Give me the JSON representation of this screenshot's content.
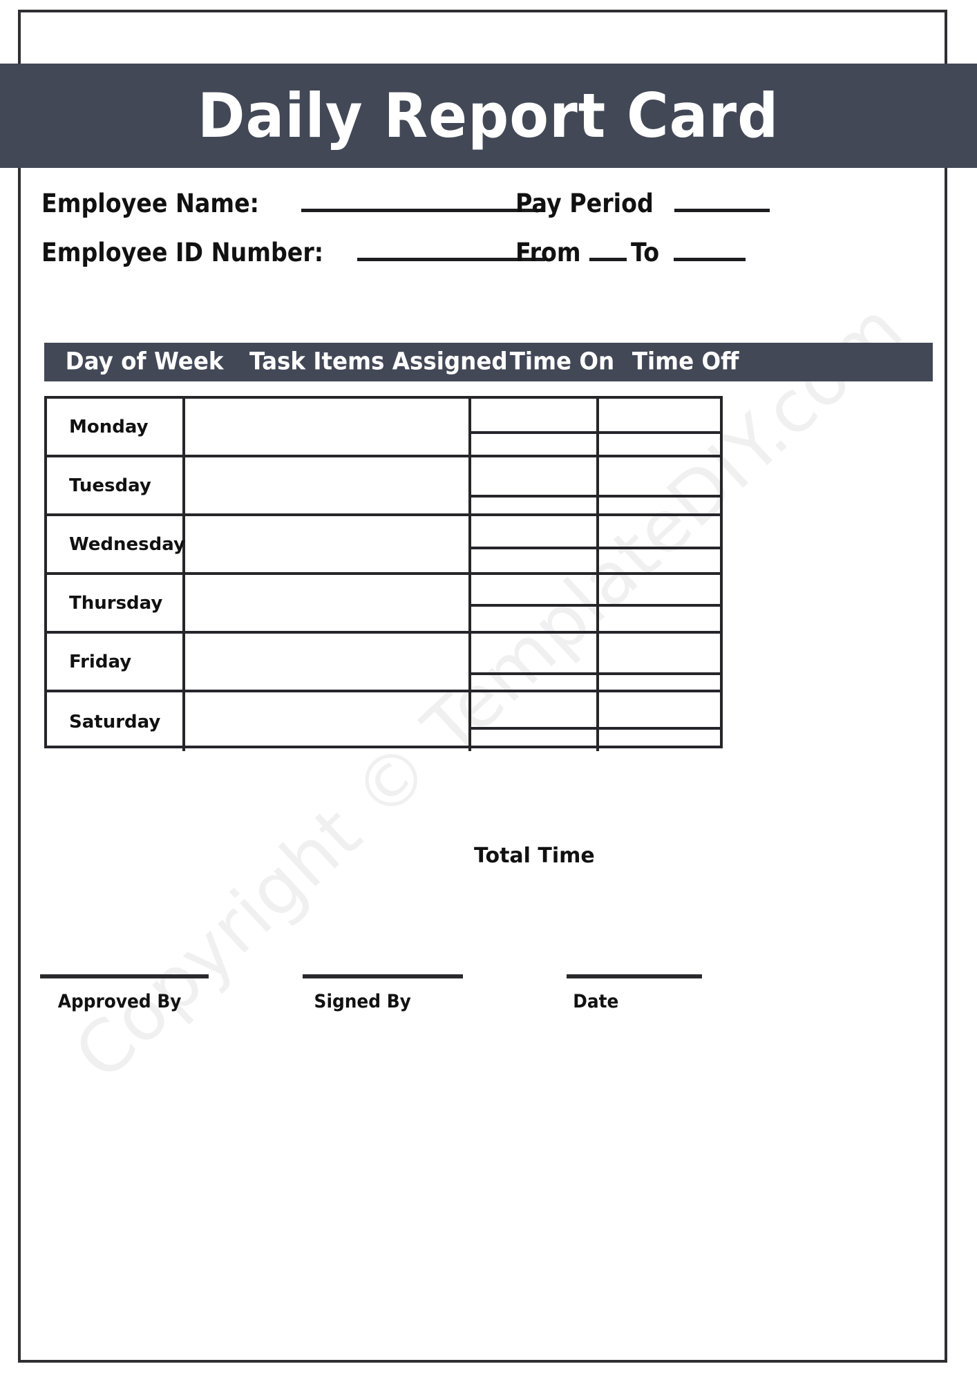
{
  "document": {
    "title": "Daily Report Card",
    "watermark": "Copyright © TemplateDIY.com"
  },
  "colors": {
    "banner": "#434857",
    "banner_text": "#ffffff",
    "rule": "#1d1d1f",
    "border": "#25252a",
    "text": "#111111"
  },
  "header_fields": {
    "employee_name_label": "Employee Name:",
    "employee_id_label": "Employee ID Number:",
    "pay_period_label": "Pay Period",
    "from_label": "From",
    "to_label": "To",
    "employee_name_value": "",
    "employee_id_value": "",
    "pay_period_value": "",
    "from_value": "",
    "to_value": ""
  },
  "table": {
    "columns": [
      "Day of Week",
      "Task Items Assigned",
      "Time On",
      "Time Off"
    ],
    "rows": [
      {
        "day": "Monday",
        "task": "",
        "time_on_1": "",
        "time_on_2": "",
        "time_off_1": "",
        "time_off_2": ""
      },
      {
        "day": "Tuesday",
        "task": "",
        "time_on_1": "",
        "time_on_2": "",
        "time_off_1": "",
        "time_off_2": ""
      },
      {
        "day": "Wednesday",
        "task": "",
        "time_on_1": "",
        "time_on_2": "",
        "time_off_1": "",
        "time_off_2": ""
      },
      {
        "day": "Thursday",
        "task": "",
        "time_on_1": "",
        "time_on_2": "",
        "time_off_1": "",
        "time_off_2": ""
      },
      {
        "day": "Friday",
        "task": "",
        "time_on_1": "",
        "time_on_2": "",
        "time_off_1": "",
        "time_off_2": ""
      },
      {
        "day": "Saturday",
        "task": "",
        "time_on_1": "",
        "time_on_2": "",
        "time_off_1": "",
        "time_off_2": ""
      }
    ]
  },
  "summary": {
    "total_time_label": "Total Time",
    "total_time_value": ""
  },
  "signatures": [
    {
      "label": "Approved By",
      "value": ""
    },
    {
      "label": "Signed By",
      "value": ""
    },
    {
      "label": "Date",
      "value": ""
    }
  ]
}
